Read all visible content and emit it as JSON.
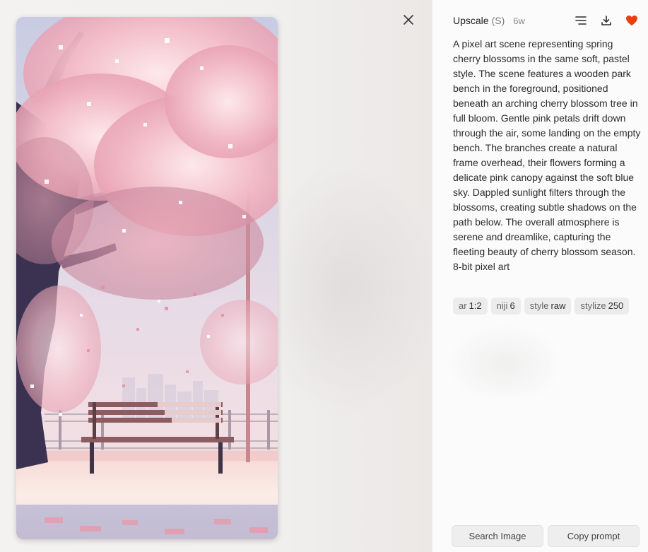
{
  "viewer": {
    "close_icon": "close-icon",
    "artwork_palette": {
      "sky": "#c9cde4",
      "blossom": "#f0b6c2",
      "blossom_light": "#fbe1e6",
      "trunk": "#3a3250",
      "bench": "#8a5a5e",
      "ground": "#f7e6e2",
      "path_shadow": "#8e8fc2"
    }
  },
  "panel": {
    "job_type": "Upscale",
    "job_variant": "(S)",
    "job_age": "6w",
    "actions": {
      "menu_icon": "list-icon",
      "download_icon": "download-icon",
      "favorite_icon": "heart-icon",
      "favorite_color": "#e8410f"
    },
    "prompt": "A pixel art scene representing spring cherry blossoms in the same soft, pastel style. The scene features a wooden park bench in the foreground, positioned beneath an arching cherry blossom tree in full bloom. Gentle pink petals drift down through the air, some landing on the empty bench. The branches create a natural frame overhead, their flowers forming a delicate pink canopy against the soft blue sky. Dappled sunlight filters through the blossoms, creating subtle shadows on the path below. The overall atmosphere is serene and dreamlike, capturing the fleeting beauty of cherry blossom season. 8-bit pixel art",
    "params": [
      {
        "key": "ar",
        "value": "1:2"
      },
      {
        "key": "niji",
        "value": "6"
      },
      {
        "key": "style",
        "value": "raw"
      },
      {
        "key": "stylize",
        "value": "250"
      }
    ],
    "buttons": {
      "search_image": "Search Image",
      "copy_prompt": "Copy prompt"
    }
  }
}
